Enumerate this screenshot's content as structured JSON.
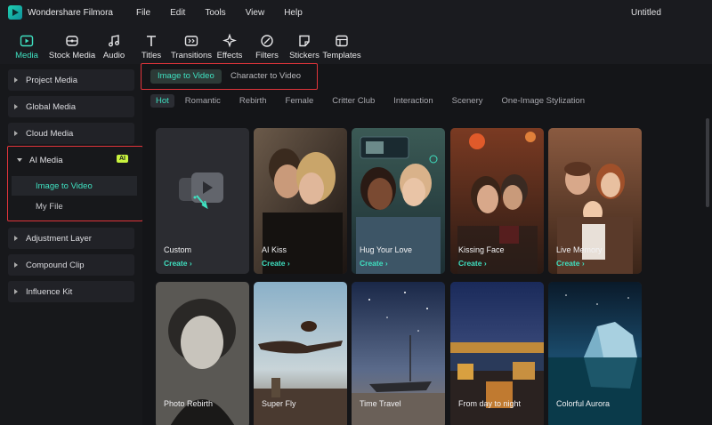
{
  "app": {
    "name": "Wondershare Filmora",
    "doc_title": "Untitled"
  },
  "menu": [
    "File",
    "Edit",
    "Tools",
    "View",
    "Help"
  ],
  "toolbar": [
    {
      "label": "Media",
      "icon": "media-icon",
      "active": true
    },
    {
      "label": "Stock Media",
      "icon": "stock-media-icon"
    },
    {
      "label": "Audio",
      "icon": "audio-icon"
    },
    {
      "label": "Titles",
      "icon": "titles-icon"
    },
    {
      "label": "Transitions",
      "icon": "transitions-icon"
    },
    {
      "label": "Effects",
      "icon": "effects-icon"
    },
    {
      "label": "Filters",
      "icon": "filters-icon"
    },
    {
      "label": "Stickers",
      "icon": "stickers-icon"
    },
    {
      "label": "Templates",
      "icon": "templates-icon"
    }
  ],
  "sidebar": {
    "items": [
      "Project Media",
      "Global Media",
      "Cloud Media"
    ],
    "ai_media": {
      "label": "AI Media",
      "badge": "AI",
      "subitems": [
        "Image to Video",
        "My File"
      ]
    },
    "items_after": [
      "Adjustment Layer",
      "Compound Clip",
      "Influence Kit"
    ]
  },
  "tabs": [
    "Image to Video",
    "Character to Video"
  ],
  "categories": [
    "Hot",
    "Romantic",
    "Rebirth",
    "Female",
    "Critter Club",
    "Interaction",
    "Scenery",
    "One-Image Stylization"
  ],
  "cards": [
    {
      "title": "Custom",
      "action": "Create"
    },
    {
      "title": "AI Kiss",
      "action": "Create"
    },
    {
      "title": "Hug Your Love",
      "action": "Create"
    },
    {
      "title": "Kissing Face",
      "action": "Create"
    },
    {
      "title": "Live Memory",
      "action": "Create"
    },
    {
      "title": "Photo Rebirth"
    },
    {
      "title": "Super Fly"
    },
    {
      "title": "Time Travel"
    },
    {
      "title": "From day to night"
    },
    {
      "title": "Colorful Aurora"
    }
  ],
  "colors": {
    "accent": "#3fe0c0",
    "highlight": "#e0343a",
    "ai_badge": "#c8f33e"
  }
}
